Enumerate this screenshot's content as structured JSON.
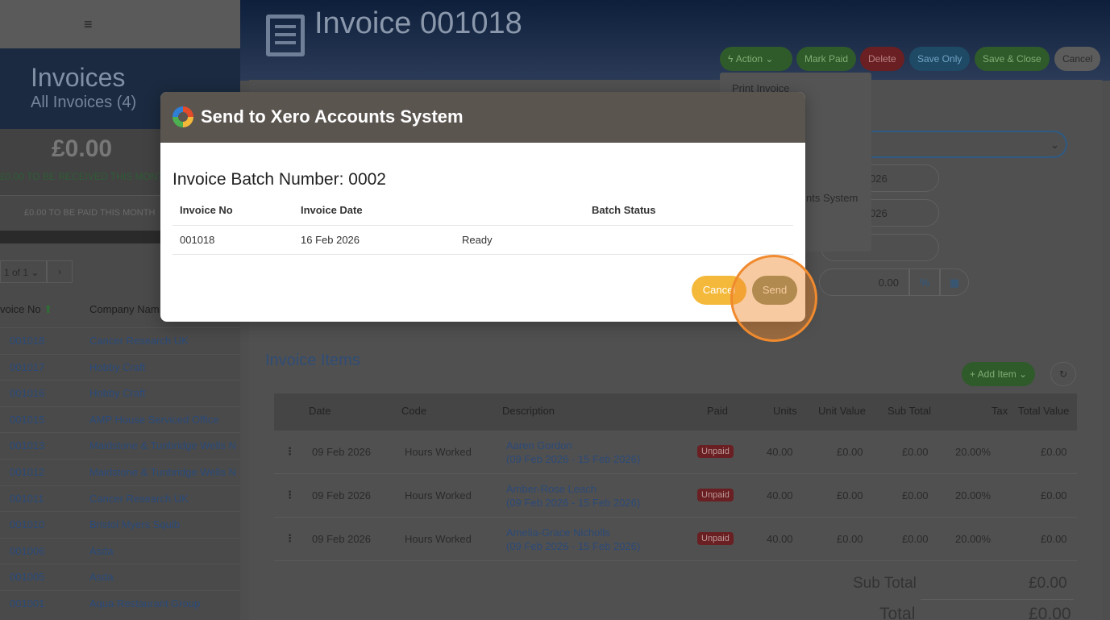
{
  "left": {
    "menu_icon": "≡",
    "title": "Invoices",
    "subtitle": "All Invoices (4)",
    "amount": "£0.00",
    "amount_note": "£0.00 TO BE RECEIVED THIS MONTH",
    "paid_note": "£0.00 TO BE PAID THIS MONTH",
    "pager": "1 of 1 ⌄",
    "pager_next": "›",
    "col_no": "voice No",
    "col_company": "Company Nam",
    "rows": [
      {
        "no": "001018",
        "co": "Cancer Research UK"
      },
      {
        "no": "001017",
        "co": "Hobby Craft"
      },
      {
        "no": "001016",
        "co": "Hobby Craft"
      },
      {
        "no": "001015",
        "co": "AMP House Serviced Office"
      },
      {
        "no": "001013",
        "co": "Maidstone & Tunbridge Wells N"
      },
      {
        "no": "001012",
        "co": "Maidstone & Tunbridge Wells N"
      },
      {
        "no": "001011",
        "co": "Cancer Research UK"
      },
      {
        "no": "001010",
        "co": "Bristol Myers Squib"
      },
      {
        "no": "001006",
        "co": "Asda"
      },
      {
        "no": "001005",
        "co": "Asda"
      },
      {
        "no": "001001",
        "co": "Aqua Restaurant Group"
      }
    ]
  },
  "right": {
    "title": "Invoice 001018",
    "buttons": {
      "action": "Action",
      "mark_paid": "Mark Paid",
      "delete": "Delete",
      "save_only": "Save Only",
      "save_close": "Save & Close",
      "cancel": "Cancel"
    },
    "dropdown": {
      "print": "Print Invoice",
      "send_accounts": "nts System"
    },
    "fields": {
      "date1": "026",
      "date2": "026",
      "discount": "0.00",
      "percent": "%"
    },
    "items_title": "Invoice Items",
    "add_item": "+ Add Item ⌄",
    "columns": [
      "Date",
      "Code",
      "Description",
      "Paid",
      "Units",
      "Unit Value",
      "Sub Total",
      "Tax",
      "Total Value"
    ],
    "items": [
      {
        "date": "09 Feb 2026",
        "code": "Hours Worked",
        "name": "Aaren Gordon",
        "range": "(09 Feb 2026 - 15 Feb 2026)",
        "paid": "Unpaid",
        "units": "40.00",
        "unit_value": "£0.00",
        "sub": "£0.00",
        "tax": "20.00%",
        "total": "£0.00"
      },
      {
        "date": "09 Feb 2026",
        "code": "Hours Worked",
        "name": "Amber-Rose Leach",
        "range": "(09 Feb 2026 - 15 Feb 2026)",
        "paid": "Unpaid",
        "units": "40.00",
        "unit_value": "£0.00",
        "sub": "£0.00",
        "tax": "20.00%",
        "total": "£0.00"
      },
      {
        "date": "09 Feb 2026",
        "code": "Hours Worked",
        "name": "Amelia-Grace Nicholls",
        "range": "(09 Feb 2026 - 15 Feb 2026)",
        "paid": "Unpaid",
        "units": "40.00",
        "unit_value": "£0.00",
        "sub": "£0.00",
        "tax": "20.00%",
        "total": "£0.00"
      }
    ],
    "subtotal_label": "Sub Total",
    "subtotal_value": "£0.00",
    "total_label": "Total",
    "total_value": "£0.00"
  },
  "modal": {
    "title": "Send to Xero Accounts System",
    "batch": "Invoice Batch Number: 0002",
    "col_invoice_no": "Invoice No",
    "col_invoice_date": "Invoice Date",
    "col_batch_status": "Batch Status",
    "row": {
      "no": "001018",
      "date": "16 Feb 2026",
      "status": "Ready"
    },
    "cancel": "Cancel",
    "send": "Send"
  },
  "colors": {
    "accent_green": "#4f8f3a",
    "danger": "#9a2f2f",
    "info": "#2e6f9a",
    "modal_header": "#5b5550",
    "highlight": "#f08a2e"
  }
}
